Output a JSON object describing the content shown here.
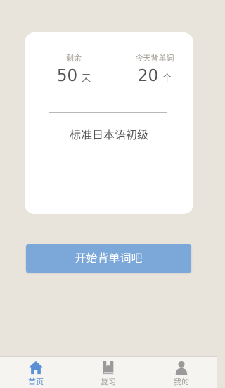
{
  "card": {
    "remaining": {
      "label": "剩余",
      "value": "50",
      "unit": "天"
    },
    "today": {
      "label": "今天背单词",
      "value": "20",
      "unit": "个"
    },
    "book_title": "标准日本语初级"
  },
  "start_button": {
    "label": "开始背单词吧"
  },
  "tabs": [
    {
      "label": "首页",
      "icon": "home-icon",
      "active": true
    },
    {
      "label": "复习",
      "icon": "book-icon",
      "active": false
    },
    {
      "label": "我的",
      "icon": "user-icon",
      "active": false
    }
  ],
  "colors": {
    "background": "#e8e4dc",
    "card": "#ffffff",
    "button": "#7ba8d8",
    "active_tab": "#5b8fd6",
    "inactive_tab": "#9a9a9a"
  }
}
